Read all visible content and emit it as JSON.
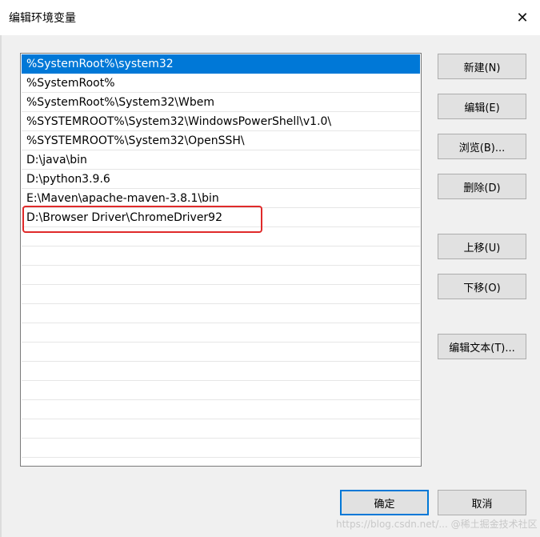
{
  "window": {
    "title": "编辑环境变量",
    "close_glyph": "✕"
  },
  "list": {
    "items": [
      "%SystemRoot%\\system32",
      "%SystemRoot%",
      "%SystemRoot%\\System32\\Wbem",
      "%SYSTEMROOT%\\System32\\WindowsPowerShell\\v1.0\\",
      "%SYSTEMROOT%\\System32\\OpenSSH\\",
      "D:\\java\\bin",
      "D:\\python3.9.6",
      "E:\\Maven\\apache-maven-3.8.1\\bin",
      "D:\\Browser Driver\\ChromeDriver92",
      "",
      "",
      "",
      "",
      "",
      "",
      "",
      "",
      "",
      "",
      "",
      ""
    ]
  },
  "buttons": {
    "new": "新建(N)",
    "edit": "编辑(E)",
    "browse": "浏览(B)...",
    "delete": "删除(D)",
    "move_up": "上移(U)",
    "move_down": "下移(O)",
    "edit_text": "编辑文本(T)...",
    "ok": "确定",
    "cancel": "取消"
  },
  "watermark": "https://blog.csdn.net/...  @稀土掘金技术社区",
  "colors": {
    "selection": "#0078d7",
    "highlight": "#e02a2a"
  }
}
